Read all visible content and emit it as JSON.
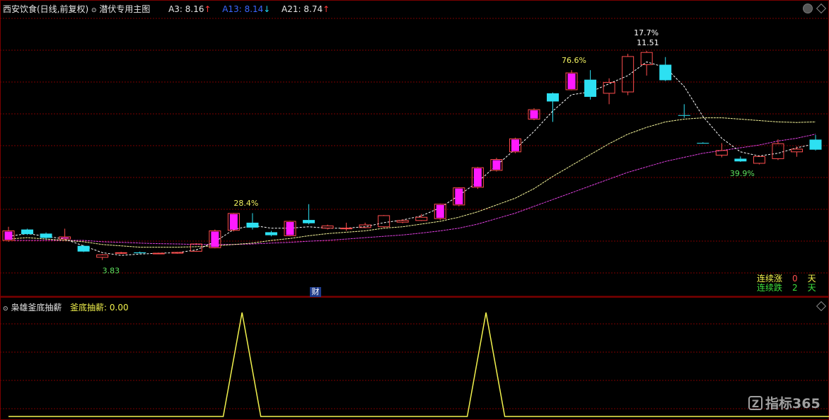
{
  "header": {
    "stock_name": "西安饮食(日线,前复权)",
    "template_name": "潜伏专用主图",
    "ma3_label": "A3:",
    "ma3_value": "8.16",
    "ma3_arrow": "↑",
    "ma13_label": "A13:",
    "ma13_value": "8.14",
    "ma13_arrow": "↓",
    "ma21_label": "A21:",
    "ma21_value": "8.74",
    "ma21_arrow": "↑"
  },
  "sub_header": {
    "indicator_name": "枭雄釜底抽薪",
    "value_label": "釜底抽薪:",
    "value": "0.00"
  },
  "stats": {
    "rise_label": "连续涨",
    "rise_value": "0",
    "rise_unit": "天",
    "fall_label": "连续跌",
    "fall_value": "2",
    "fall_unit": "天"
  },
  "markers": {
    "finance": "财"
  },
  "watermark": {
    "logo_text": "指标365"
  },
  "colors": {
    "up_candle": "#ff4d4d",
    "down_candle": "#2de0f2",
    "strong_up": "#ff1aff",
    "ma_fast": "#ffffff",
    "ma_mid": "#f5f59a",
    "ma_slow": "#e040e0",
    "indicator_line": "#f2f24d",
    "grid": "#7a0000"
  },
  "chart_data": [
    {
      "type": "candlestick",
      "ylim": [
        3.2,
        12.7
      ],
      "annotations": [
        {
          "text": "28.4%",
          "candle": 12
        },
        {
          "text": "76.6%",
          "candle": 30
        },
        {
          "text": "17.7%",
          "candle": 34
        },
        {
          "text": "11.51",
          "candle": 34
        },
        {
          "text": "39.9%",
          "candle": 39
        },
        {
          "text": "3.83",
          "candle": 5
        }
      ],
      "candles": [
        {
          "o": 4.9,
          "h": 5.05,
          "l": 4.5,
          "c": 4.55,
          "s": "strong"
        },
        {
          "o": 4.95,
          "h": 4.98,
          "l": 4.75,
          "c": 4.78,
          "s": "down"
        },
        {
          "o": 4.8,
          "h": 4.84,
          "l": 4.6,
          "c": 4.64,
          "s": "down"
        },
        {
          "o": 4.68,
          "h": 4.98,
          "l": 4.56,
          "c": 4.6,
          "s": "strong"
        },
        {
          "o": 4.35,
          "h": 4.38,
          "l": 4.12,
          "c": 4.14,
          "s": "down"
        },
        {
          "o": 4.02,
          "h": 4.05,
          "l": 3.83,
          "c": 3.93,
          "s": "up"
        },
        {
          "o": 4.1,
          "h": 4.13,
          "l": 4.05,
          "c": 4.08,
          "s": "up"
        },
        {
          "o": 4.11,
          "h": 4.14,
          "l": 4.07,
          "c": 4.08,
          "s": "down"
        },
        {
          "o": 4.07,
          "h": 4.1,
          "l": 4.05,
          "c": 4.08,
          "s": "up"
        },
        {
          "o": 4.08,
          "h": 4.13,
          "l": 4.06,
          "c": 4.11,
          "s": "up"
        },
        {
          "o": 4.15,
          "h": 4.45,
          "l": 4.13,
          "c": 4.42,
          "s": "up"
        },
        {
          "o": 4.28,
          "h": 4.95,
          "l": 4.26,
          "c": 4.9,
          "s": "strong"
        },
        {
          "o": 4.92,
          "h": 5.56,
          "l": 4.88,
          "c": 5.54,
          "s": "strong"
        },
        {
          "o": 5.2,
          "h": 5.55,
          "l": 4.95,
          "c": 5.02,
          "s": "down"
        },
        {
          "o": 4.85,
          "h": 4.9,
          "l": 4.7,
          "c": 4.74,
          "s": "down"
        },
        {
          "o": 4.72,
          "h": 5.27,
          "l": 4.7,
          "c": 5.25,
          "s": "strong"
        },
        {
          "o": 5.3,
          "h": 5.88,
          "l": 5.14,
          "c": 5.18,
          "s": "down"
        },
        {
          "o": 5.0,
          "h": 5.13,
          "l": 4.95,
          "c": 5.08,
          "s": "up"
        },
        {
          "o": 4.98,
          "h": 5.2,
          "l": 4.9,
          "c": 5.0,
          "s": "up"
        },
        {
          "o": 5.02,
          "h": 5.2,
          "l": 5.0,
          "c": 5.12,
          "s": "up"
        },
        {
          "o": 5.05,
          "h": 5.48,
          "l": 5.02,
          "c": 5.46,
          "s": "up"
        },
        {
          "o": 5.22,
          "h": 5.32,
          "l": 5.18,
          "c": 5.28,
          "s": "up"
        },
        {
          "o": 5.28,
          "h": 5.52,
          "l": 5.26,
          "c": 5.4,
          "s": "up"
        },
        {
          "o": 5.35,
          "h": 5.9,
          "l": 5.3,
          "c": 5.88,
          "s": "strong"
        },
        {
          "o": 5.85,
          "h": 6.5,
          "l": 5.8,
          "c": 6.48,
          "s": "strong"
        },
        {
          "o": 6.5,
          "h": 7.25,
          "l": 6.44,
          "c": 7.22,
          "s": "strong"
        },
        {
          "o": 7.12,
          "h": 7.58,
          "l": 7.08,
          "c": 7.52,
          "s": "strong"
        },
        {
          "o": 7.8,
          "h": 8.32,
          "l": 7.75,
          "c": 8.28,
          "s": "strong"
        },
        {
          "o": 9.0,
          "h": 9.4,
          "l": 8.96,
          "c": 9.35,
          "s": "strong"
        },
        {
          "o": 9.95,
          "h": 9.98,
          "l": 8.9,
          "c": 9.65,
          "s": "down"
        },
        {
          "o": 10.08,
          "h": 10.8,
          "l": 10.06,
          "c": 10.7,
          "s": "strong"
        },
        {
          "o": 10.45,
          "h": 10.8,
          "l": 9.72,
          "c": 9.82,
          "s": "down"
        },
        {
          "o": 9.95,
          "h": 10.5,
          "l": 9.55,
          "c": 10.35,
          "s": "up"
        },
        {
          "o": 10.0,
          "h": 11.4,
          "l": 9.88,
          "c": 11.3,
          "s": "up"
        },
        {
          "o": 11.0,
          "h": 11.51,
          "l": 10.6,
          "c": 11.45,
          "s": "up"
        },
        {
          "o": 11.0,
          "h": 11.28,
          "l": 10.4,
          "c": 10.43,
          "s": "down"
        },
        {
          "o": 9.15,
          "h": 9.55,
          "l": 9.05,
          "c": 9.13,
          "s": "down"
        },
        {
          "o": 8.12,
          "h": 8.15,
          "l": 8.1,
          "c": 8.13,
          "s": "down"
        },
        {
          "o": 7.68,
          "h": 8.12,
          "l": 7.6,
          "c": 7.85,
          "s": "up"
        },
        {
          "o": 7.55,
          "h": 7.63,
          "l": 7.43,
          "c": 7.45,
          "s": "down"
        },
        {
          "o": 7.38,
          "h": 7.64,
          "l": 7.34,
          "c": 7.63,
          "s": "up"
        },
        {
          "o": 7.55,
          "h": 8.26,
          "l": 7.5,
          "c": 8.1,
          "s": "up"
        },
        {
          "o": 7.8,
          "h": 8.0,
          "l": 7.62,
          "c": 7.9,
          "s": "up"
        },
        {
          "o": 8.25,
          "h": 8.42,
          "l": 7.85,
          "c": 7.88,
          "s": "down"
        }
      ],
      "ma_mid": [
        4.6,
        4.65,
        4.6,
        4.55,
        4.5,
        4.4,
        4.35,
        4.3,
        4.3,
        4.3,
        4.32,
        4.35,
        4.4,
        4.45,
        4.55,
        4.62,
        4.72,
        4.8,
        4.85,
        4.9,
        5.0,
        5.05,
        5.15,
        5.25,
        5.4,
        5.6,
        5.85,
        6.1,
        6.45,
        6.9,
        7.3,
        7.7,
        8.1,
        8.45,
        8.7,
        8.9,
        9.0,
        9.05,
        9.05,
        9.0,
        8.95,
        8.9,
        8.88,
        8.9
      ],
      "ma_slow": [
        4.55,
        4.55,
        4.55,
        4.55,
        4.55,
        4.5,
        4.48,
        4.45,
        4.43,
        4.42,
        4.4,
        4.4,
        4.4,
        4.42,
        4.45,
        4.48,
        4.52,
        4.55,
        4.6,
        4.65,
        4.7,
        4.75,
        4.82,
        4.9,
        5.0,
        5.15,
        5.35,
        5.55,
        5.8,
        6.05,
        6.3,
        6.55,
        6.8,
        7.05,
        7.25,
        7.45,
        7.6,
        7.75,
        7.85,
        7.95,
        8.05,
        8.2,
        8.3,
        8.45
      ],
      "ma_fast": [
        4.7,
        4.8,
        4.7,
        4.6,
        4.35,
        4.1,
        4.0,
        4.05,
        4.08,
        4.1,
        4.2,
        4.5,
        4.95,
        5.1,
        5.0,
        5.0,
        5.05,
        5.0,
        5.0,
        5.05,
        5.2,
        5.3,
        5.45,
        5.75,
        6.2,
        6.7,
        7.3,
        7.9,
        8.55,
        9.3,
        9.9,
        10.0,
        10.3,
        10.6,
        11.1,
        10.9,
        10.2,
        9.1,
        8.3,
        7.8,
        7.65,
        7.75,
        7.95,
        8.1
      ]
    },
    {
      "type": "line",
      "series": [
        {
          "values": [
            0,
            0,
            0,
            0,
            0,
            0,
            0,
            0,
            0,
            0,
            0,
            0,
            1,
            0,
            0,
            0,
            0,
            0,
            0,
            0,
            0,
            0,
            0,
            0,
            0,
            1,
            0,
            0,
            0,
            0,
            0,
            0,
            0,
            0,
            0,
            0,
            0,
            0,
            0,
            0,
            0,
            0,
            0,
            0,
            0
          ]
        }
      ],
      "ylim": [
        0,
        1
      ]
    }
  ]
}
